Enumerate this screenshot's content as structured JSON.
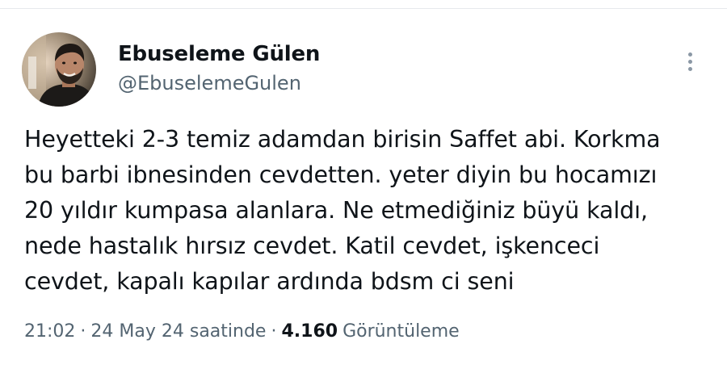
{
  "author": {
    "display_name": "Ebuseleme Gülen",
    "handle": "@EbuselemeGulen"
  },
  "tweet": {
    "lines": [
      "Heyetteki 2-3 temiz adamdan birisin Saffet abi. Korkma",
      "bu barbi ibnesinden cevdetten. yeter diyin bu hocamızı",
      "20 yıldır kumpasa alanlara. Ne etmediğiniz büyü kaldı,",
      "nede hastalık hırsız cevdet. Katil cevdet, işkenceci",
      "cevdet, kapalı kapılar ardında bdsm ci seni"
    ]
  },
  "meta": {
    "time": "21:02",
    "separator": "·",
    "date": "24 May 24 saatinde",
    "views_count": "4.160",
    "views_label": "Görüntüleme"
  },
  "icons": {
    "more": "more-vertical-icon",
    "avatar": "profile-photo"
  },
  "colors": {
    "text_primary": "#0f1419",
    "text_secondary": "#536471",
    "icon_gray": "#8b98a5"
  }
}
